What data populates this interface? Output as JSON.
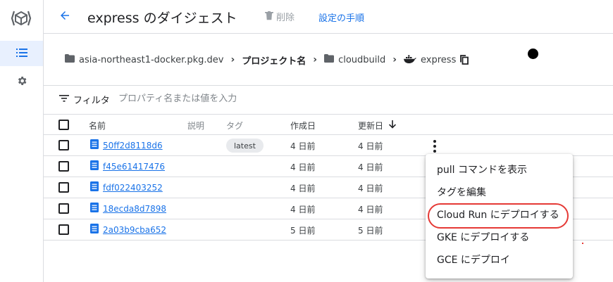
{
  "header": {
    "title": "express のダイジェスト",
    "delete_label": "削除",
    "setup_label": "設定の手順"
  },
  "nav": {
    "items": [
      {
        "icon": "list-icon",
        "active": true
      },
      {
        "icon": "gear-icon",
        "active": false
      }
    ]
  },
  "breadcrumb": {
    "items": [
      {
        "label": "asia-northeast1-docker.pkg.dev",
        "icon": "folder-icon"
      },
      {
        "label": "プロジェクト名",
        "icon": ""
      },
      {
        "label": "cloudbuild",
        "icon": "folder-icon"
      },
      {
        "label": "express",
        "icon": "docker-icon"
      }
    ]
  },
  "filter": {
    "label": "フィルタ",
    "placeholder": "プロパティ名または値を入力"
  },
  "table": {
    "columns": {
      "name": "名前",
      "description": "説明",
      "tags": "タグ",
      "created": "作成日",
      "updated": "更新日"
    },
    "rows": [
      {
        "digest": "50ff2d8118d6",
        "tag": "latest",
        "created": "4 日前",
        "updated": "4 日前"
      },
      {
        "digest": "f45e61417476",
        "tag": "",
        "created": "4 日前",
        "updated": "4 日前"
      },
      {
        "digest": "fdf022403252",
        "tag": "",
        "created": "4 日前",
        "updated": "4 日前"
      },
      {
        "digest": "18ecda8d7898",
        "tag": "",
        "created": "4 日前",
        "updated": "4 日前"
      },
      {
        "digest": "2a03b9cba652",
        "tag": "",
        "created": "5 日前",
        "updated": "5 日前"
      }
    ]
  },
  "menu": {
    "items": [
      "pull コマンドを表示",
      "タグを編集",
      "Cloud Run にデプロイする",
      "GKE にデプロイする",
      "GCE にデプロイ"
    ],
    "highlighted_index": 2
  },
  "colors": {
    "accent": "#1a73e8",
    "highlight_ring": "#e53935",
    "divider": "#dadce0",
    "nav_active_bg": "#e8f0fe"
  }
}
